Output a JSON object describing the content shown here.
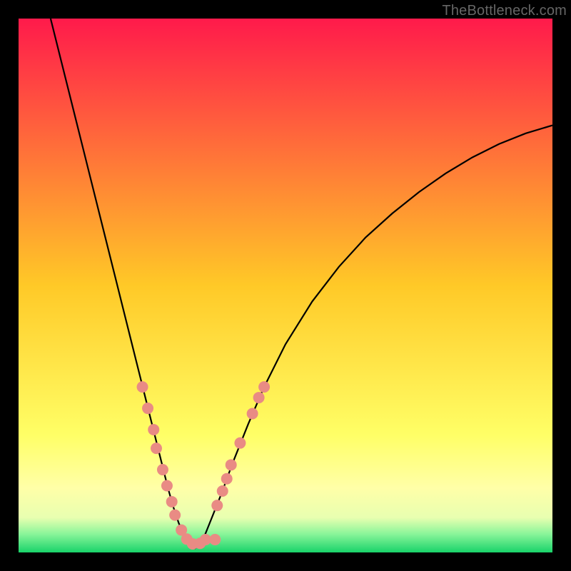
{
  "watermark": "TheBottleneck.com",
  "chart_data": {
    "type": "line",
    "title": "",
    "xlabel": "",
    "ylabel": "",
    "xlim": [
      0,
      100
    ],
    "ylim": [
      0,
      100
    ],
    "background_gradient": {
      "stops": [
        {
          "offset": 0.0,
          "color": "#ff1a4b"
        },
        {
          "offset": 0.5,
          "color": "#ffc927"
        },
        {
          "offset": 0.78,
          "color": "#ffff66"
        },
        {
          "offset": 0.88,
          "color": "#ffffa8"
        },
        {
          "offset": 0.935,
          "color": "#e8ffb0"
        },
        {
          "offset": 0.965,
          "color": "#8bf59a"
        },
        {
          "offset": 1.0,
          "color": "#19d36a"
        }
      ]
    },
    "series": [
      {
        "name": "bottleneck-curve-left",
        "x": [
          6,
          8,
          10,
          12,
          14,
          16,
          18,
          20,
          21,
          22,
          23,
          24,
          25,
          26,
          27,
          28,
          29,
          30,
          31,
          32,
          33
        ],
        "y": [
          100,
          92,
          84,
          76,
          68,
          60,
          52,
          44,
          40,
          36,
          32,
          28,
          24,
          20,
          16,
          12,
          8.5,
          5.5,
          3.2,
          1.6,
          0.7
        ]
      },
      {
        "name": "bottleneck-curve-right",
        "x": [
          33,
          34,
          35,
          36,
          38,
          40,
          43,
          46,
          50,
          55,
          60,
          65,
          70,
          75,
          80,
          85,
          90,
          95,
          100
        ],
        "y": [
          0.7,
          1.8,
          3.5,
          6,
          11,
          16.5,
          24,
          31,
          39,
          47,
          53.5,
          59,
          63.5,
          67.5,
          71,
          74,
          76.5,
          78.5,
          80
        ]
      }
    ],
    "scatter": {
      "name": "sample-points",
      "color": "#e98b84",
      "radius": 8,
      "points": [
        {
          "x": 23.2,
          "y": 31.0
        },
        {
          "x": 24.2,
          "y": 27.0
        },
        {
          "x": 25.3,
          "y": 23.0
        },
        {
          "x": 25.8,
          "y": 19.5
        },
        {
          "x": 27.0,
          "y": 15.5
        },
        {
          "x": 27.8,
          "y": 12.5
        },
        {
          "x": 28.7,
          "y": 9.5
        },
        {
          "x": 29.3,
          "y": 7.0
        },
        {
          "x": 30.5,
          "y": 4.2
        },
        {
          "x": 31.5,
          "y": 2.5
        },
        {
          "x": 32.6,
          "y": 1.6
        },
        {
          "x": 34.0,
          "y": 1.7
        },
        {
          "x": 35.0,
          "y": 2.4
        },
        {
          "x": 36.8,
          "y": 2.4
        },
        {
          "x": 37.2,
          "y": 8.8
        },
        {
          "x": 38.2,
          "y": 11.5
        },
        {
          "x": 39.0,
          "y": 13.8
        },
        {
          "x": 39.8,
          "y": 16.4
        },
        {
          "x": 41.5,
          "y": 20.5
        },
        {
          "x": 43.8,
          "y": 26.0
        },
        {
          "x": 45.0,
          "y": 29.0
        },
        {
          "x": 46.0,
          "y": 31.0
        }
      ]
    }
  }
}
